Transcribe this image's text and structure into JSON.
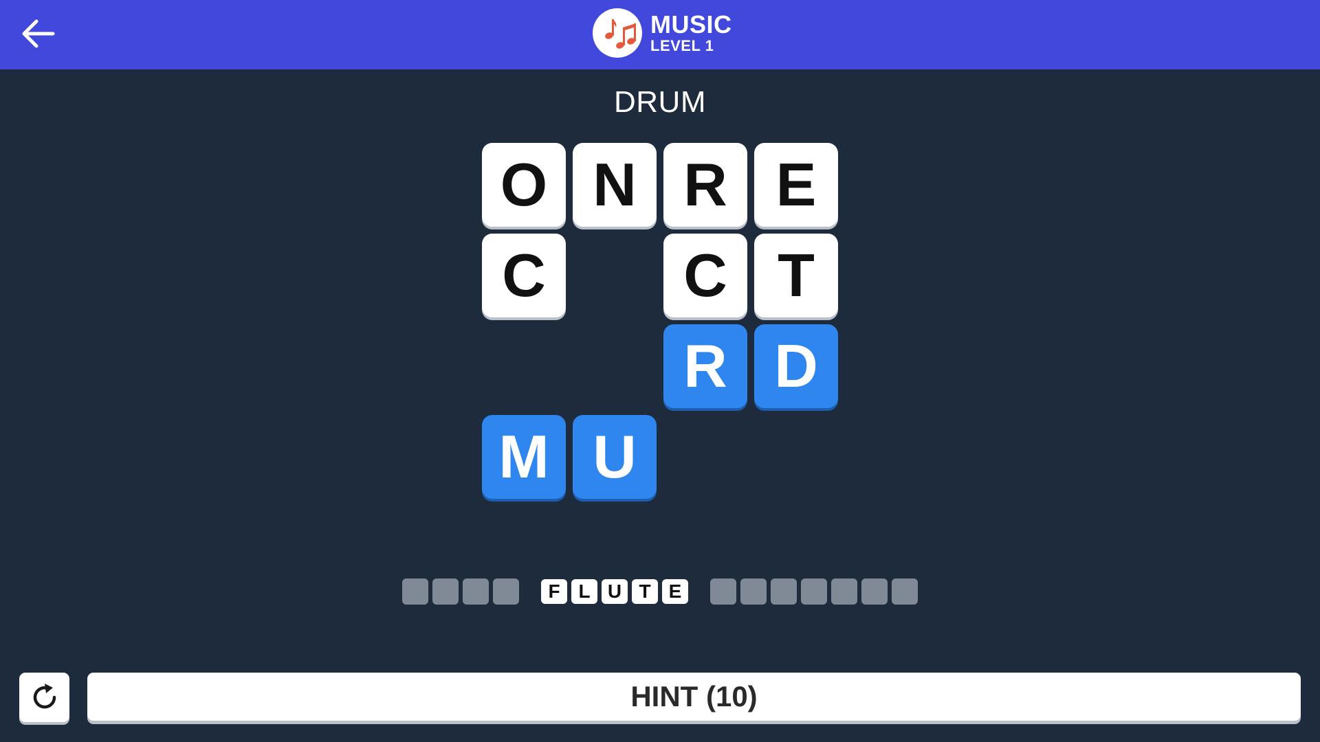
{
  "header": {
    "category": "MUSIC",
    "level": "LEVEL 1",
    "bar_color": "#4348dc",
    "logo_icon": "music-notes-icon",
    "back_icon": "arrow-left-icon"
  },
  "clue": "DRUM",
  "grid": {
    "rows": 4,
    "cols": 4,
    "cells": [
      [
        "O",
        "N",
        "R",
        "E"
      ],
      [
        "C",
        "",
        "C",
        "T"
      ],
      [
        "",
        "",
        "R",
        "D"
      ],
      [
        "M",
        "U",
        "",
        ""
      ]
    ],
    "selected": [
      [
        2,
        2
      ],
      [
        2,
        3
      ],
      [
        3,
        0
      ],
      [
        3,
        1
      ]
    ],
    "tile_color": "#ffffff",
    "selected_color": "#2f86ee"
  },
  "progress": {
    "words": [
      {
        "length": 4,
        "revealed": ""
      },
      {
        "length": 5,
        "revealed": "FLUTE"
      },
      {
        "length": 7,
        "revealed": ""
      }
    ]
  },
  "footer": {
    "reset_icon": "refresh-icon",
    "hint_label": "HINT (10)"
  }
}
